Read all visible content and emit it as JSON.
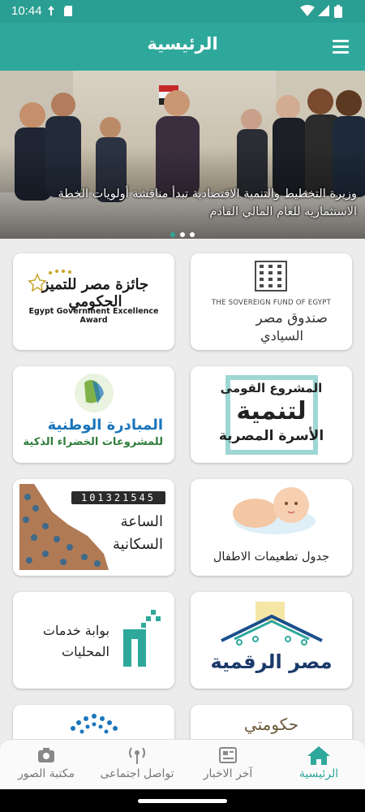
{
  "status_bar": {
    "time": "10:44"
  },
  "app_bar": {
    "title": "الرئيسية",
    "menu_icon": "hamburger-menu-icon"
  },
  "slider": {
    "caption": "وزيرة التخطيط والتنمية الاقتصادية تبدأ مناقشة أولويات الخطة الاستثمارية للعام المالي القادم",
    "slide_count": 3,
    "active_slide": 0
  },
  "cards": {
    "sovereign_fund": {
      "en": "THE SOVEREIGN FUND OF EGYPT",
      "ar_line1": "صندوق مصر",
      "ar_line2": "السيادي"
    },
    "excellence_award": {
      "ar": "جائزة مصر للتميز الحكومي",
      "en": "Egypt Government Excellence Award"
    },
    "family_development": {
      "line1": "المشروع القومى",
      "line2": "لتنمية",
      "line3": "الأسرة المصرية"
    },
    "green_projects": {
      "line1": "المبادرة الوطنية",
      "line2": "للمشروعات الخضراء الذكية"
    },
    "vaccinations": {
      "label": "جدول تطعيمات الاطفال"
    },
    "population_clock": {
      "digits": "101321545",
      "line1": "الساعة",
      "line2": "السكانية"
    },
    "digital_egypt": {
      "label": "مصر الرقمية"
    },
    "local_services": {
      "line1": "بوابة خدمات",
      "line2": "المحليات"
    },
    "partial_right": {
      "label": "حكومتي"
    }
  },
  "bottom_nav": {
    "items": [
      {
        "label": "الرئيسية",
        "icon": "home-icon",
        "active": true
      },
      {
        "label": "آخر الاخبار",
        "icon": "newspaper-icon",
        "active": false
      },
      {
        "label": "تواصل اجتماعى",
        "icon": "broadcast-icon",
        "active": false
      },
      {
        "label": "مكتبة الصور",
        "icon": "camera-icon",
        "active": false
      }
    ]
  },
  "colors": {
    "primary": "#2ea89b",
    "status_bar": "#2a9e92",
    "background": "#ececec"
  }
}
